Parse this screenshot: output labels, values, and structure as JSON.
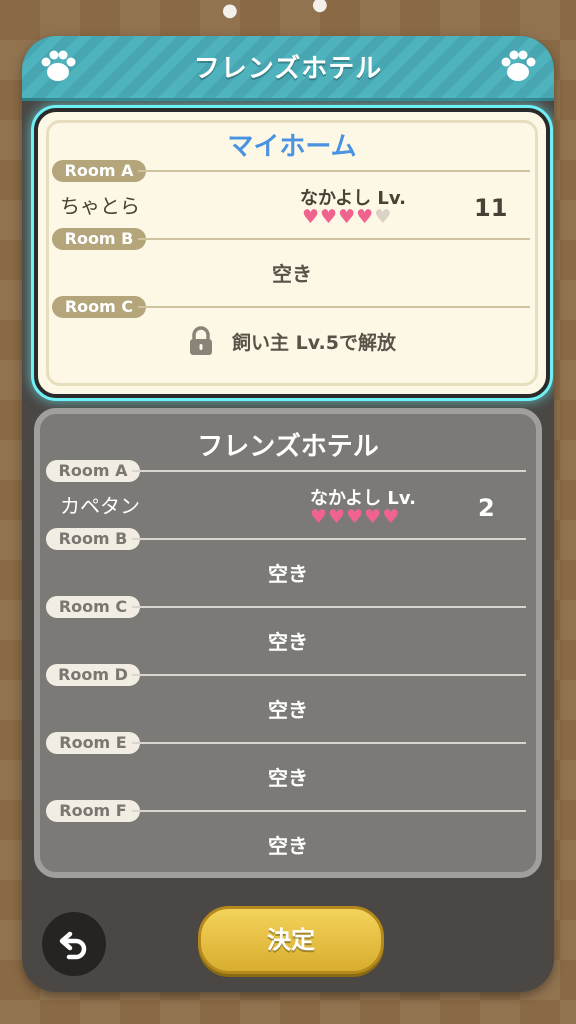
{
  "header": {
    "title": "フレンズホテル",
    "left_icon": "paw-icon",
    "right_icon": "paw-icon"
  },
  "home": {
    "title": "マイホーム",
    "rooms": [
      {
        "label": "Room A",
        "cat": "ちゃとら",
        "friendship_label": "なかよし Lv.",
        "level": "11",
        "hearts_filled": 4,
        "hearts_total": 5
      },
      {
        "label": "Room B",
        "status": "空き"
      },
      {
        "label": "Room C",
        "locked": true,
        "status": "飼い主 Lv.5で解放"
      }
    ]
  },
  "hotel": {
    "title": "フレンズホテル",
    "rooms": [
      {
        "label": "Room A",
        "cat": "カペタン",
        "friendship_label": "なかよし Lv.",
        "level": "2",
        "hearts_filled": 4.5,
        "hearts_total": 5
      },
      {
        "label": "Room B",
        "status": "空き"
      },
      {
        "label": "Room C",
        "status": "空き"
      },
      {
        "label": "Room D",
        "status": "空き"
      },
      {
        "label": "Room E",
        "status": "空き"
      },
      {
        "label": "Room F",
        "status": "空き"
      }
    ]
  },
  "footer": {
    "back_icon": "back-arrow-icon",
    "confirm_label": "決定"
  },
  "colors": {
    "accent_teal": "#4fb3bd",
    "title_blue": "#4a93e0",
    "heart_pink": "#f0638f",
    "button_gold": "#e6c046"
  }
}
